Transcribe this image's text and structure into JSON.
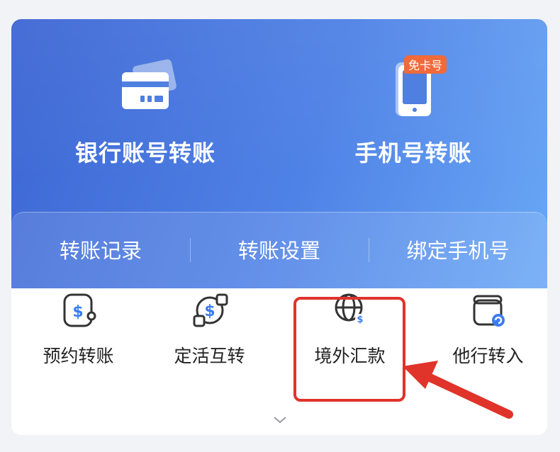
{
  "transfer": {
    "bank_account": {
      "label": "银行账号转账",
      "icon": "bank-card-icon"
    },
    "mobile": {
      "label": "手机号转账",
      "icon": "mobile-phone-icon",
      "badge": "免卡号"
    }
  },
  "links": [
    {
      "label": "转账记录"
    },
    {
      "label": "转账设置"
    },
    {
      "label": "绑定手机号"
    }
  ],
  "quick_actions": [
    {
      "label": "预约转账",
      "icon": "scheduled-dollar-icon"
    },
    {
      "label": "定活互转",
      "icon": "exchange-dollar-icon"
    },
    {
      "label": "境外汇款",
      "icon": "globe-dollar-icon",
      "highlighted": true
    },
    {
      "label": "他行转入",
      "icon": "wallet-refresh-icon"
    }
  ],
  "colors": {
    "hero_start": "#3d66d3",
    "hero_end": "#6aa8f6",
    "badge": "#f06a3b",
    "highlight": "#e0332a",
    "icon_accent": "#3b7cf0"
  }
}
